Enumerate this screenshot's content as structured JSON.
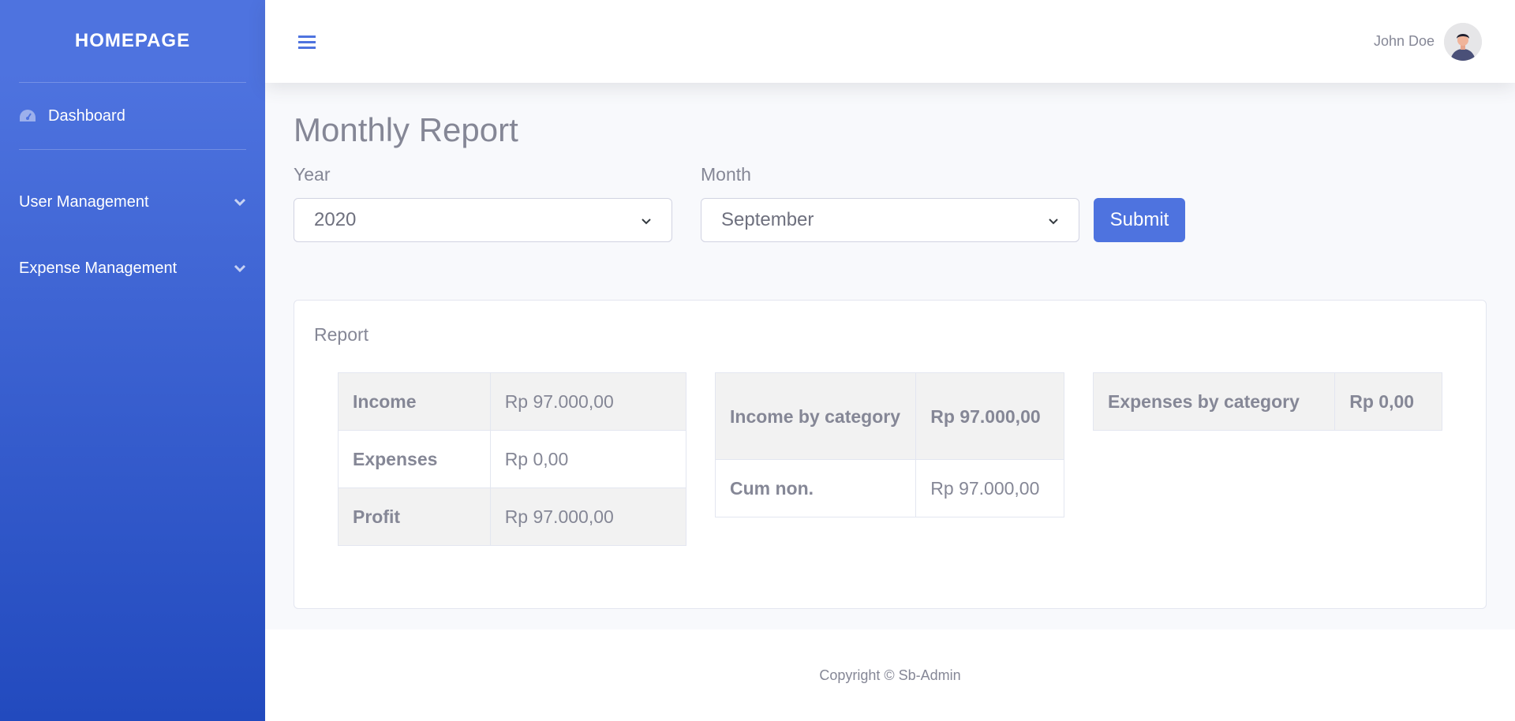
{
  "sidebar": {
    "brand": "HOMEPAGE",
    "dashboard": {
      "label": "Dashboard",
      "icon": "tachometer-icon"
    },
    "items": [
      {
        "label": "User Management",
        "icon": "chevron-down-icon"
      },
      {
        "label": "Expense Management",
        "icon": "chevron-down-icon"
      }
    ]
  },
  "topbar": {
    "toggle_icon": "hamburger-icon",
    "username": "John Doe"
  },
  "page": {
    "title": "Monthly Report",
    "year_label": "Year",
    "year_value": "2020",
    "month_label": "Month",
    "month_value": "September",
    "submit_label": "Submit"
  },
  "report": {
    "title": "Report",
    "summary": [
      {
        "key": "Income",
        "value": "Rp 97.000,00"
      },
      {
        "key": "Expenses",
        "value": "Rp 0,00"
      },
      {
        "key": "Profit",
        "value": "Rp 97.000,00"
      }
    ],
    "income_by_category": [
      {
        "key": "Income by category",
        "value": "Rp 97.000,00"
      },
      {
        "key": "Cum non.",
        "value": "Rp 97.000,00"
      }
    ],
    "expenses_by_category": [
      {
        "key": "Expenses by category",
        "value": "Rp 0,00"
      }
    ]
  },
  "footer": {
    "copyright": "Copyright © Sb-Admin"
  },
  "colors": {
    "primary": "#4e73df",
    "sidebar_end": "#224abe",
    "text": "#858796"
  }
}
